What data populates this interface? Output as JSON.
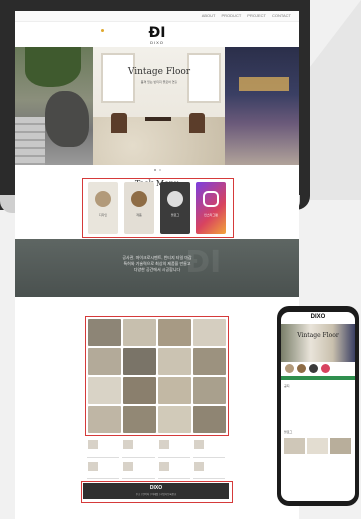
{
  "laptop": {
    "logo": {
      "mark": "ÐI",
      "word": "DIXO"
    },
    "nav": [
      "ABOUT",
      "PRODUCT",
      "PROJECT",
      "CONTACT"
    ],
    "hero": {
      "title": "Vintage Floor",
      "subtitle": "품격 있는 빈티지 플로어 연출"
    },
    "task_menu": {
      "title": "Task Menu",
      "cards": [
        {
          "label": "디자인",
          "color": "#b29a7a",
          "icon": "store-icon"
        },
        {
          "label": "제품",
          "color": "#8e6c45",
          "icon": "circle-icon"
        },
        {
          "label": "블로그",
          "color": "#3b3b3b",
          "icon": "compass-icon"
        },
        {
          "label": "인스타그램",
          "color": "#d8435f",
          "icon": "instagram-icon"
        }
      ]
    },
    "band": {
      "line1": "공사관, 마이크로시멘트, 빈티지 타일 마감",
      "line2": "특허와 기술력으로 최상의 제품을 만들고",
      "line3": "다양한 공간에서 시공합니다"
    },
    "footer": {
      "main": "DIXO",
      "small": "주소 | 연락처 | 이메일 | 사업자등록번호"
    }
  },
  "phone": {
    "logo": "DIXO",
    "hero_title": "Vintage Floor",
    "text1": "공지",
    "text2": "블로그"
  },
  "colors": {
    "highlight": "#d53a3a",
    "footer": "#2f2f2f",
    "band": "#565d5a"
  }
}
